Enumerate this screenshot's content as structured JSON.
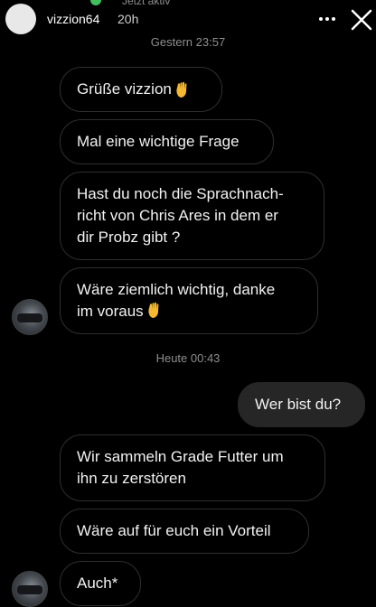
{
  "header": {
    "status": "Jetzt aktiv",
    "username": "vizzion64",
    "time": "20h",
    "status_color": "#3ec15c"
  },
  "timestamps": {
    "first": "Gestern 23:57",
    "second": "Heute 00:43"
  },
  "messages": [
    {
      "text": "Grüße vizzion",
      "icon": "waving-hand-emoji",
      "from": "them"
    },
    {
      "text": "Mal eine wichtige Frage",
      "from": "them"
    },
    {
      "text": "Hast du noch die Sprachnach-\nricht von Chris Ares in dem er\ndir Probz gibt ?",
      "from": "them"
    },
    {
      "text": "Wäre ziemlich wichtig, danke\nim voraus",
      "icon": "waving-hand-emoji",
      "from": "them"
    },
    {
      "text": "Wer bist du?",
      "from": "me"
    },
    {
      "text": "Wir sammeln Grade Futter um\nihn zu zerstören",
      "from": "them"
    },
    {
      "text": "Wäre auf für euch ein Vorteil",
      "from": "them"
    },
    {
      "text": "Auch*",
      "from": "them"
    }
  ],
  "colors": {
    "background": "#000000",
    "bubble_border": "#2f2f2f",
    "my_bubble": "#262626",
    "emoji": "#f5b82e"
  }
}
